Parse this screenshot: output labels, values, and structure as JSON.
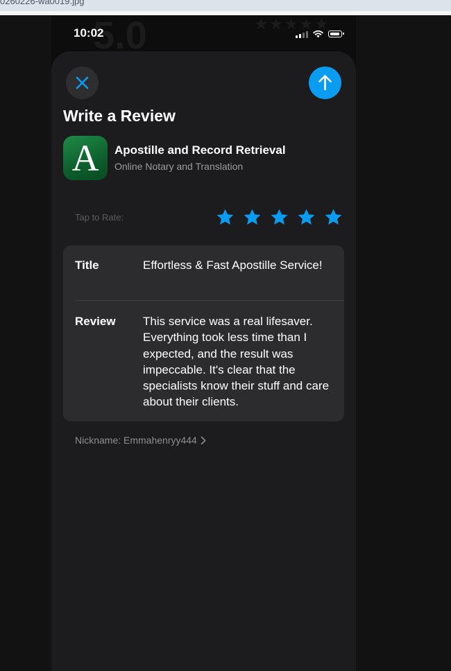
{
  "viewer": {
    "filename": "0260226-wa0019.jpg"
  },
  "status_bar": {
    "time": "10:02",
    "signal_icon": "cellular-signal-icon",
    "wifi_icon": "wifi-icon",
    "battery_icon": "battery-icon"
  },
  "background_page": {
    "rating_score": "5.0",
    "rating_stars": 5
  },
  "header": {
    "close_icon": "close-icon",
    "submit_icon": "arrow-up-icon",
    "title": "Write a Review"
  },
  "app": {
    "icon_letter": "A",
    "name": "Apostille and Record Retrieval",
    "subtitle": "Online Notary and Translation"
  },
  "rating": {
    "label": "Tap to Rate:",
    "value": 5,
    "max": 5
  },
  "form": {
    "title_label": "Title",
    "title_value": "Effortless & Fast Apostille Service!",
    "review_label": "Review",
    "review_value": "This service was a real lifesaver. Everything took less time than I expected, and the result was impeccable. It's clear that the specialists know their stuff and care about their clients."
  },
  "nickname": {
    "text": "Nickname: Emmahenryy444",
    "chevron_icon": "chevron-right-icon"
  },
  "colors": {
    "accent": "#0a9cf0",
    "sheet_background": "#1c1c1e",
    "card_background": "#2c2c2e",
    "app_icon_green": "#0d5f2c"
  }
}
